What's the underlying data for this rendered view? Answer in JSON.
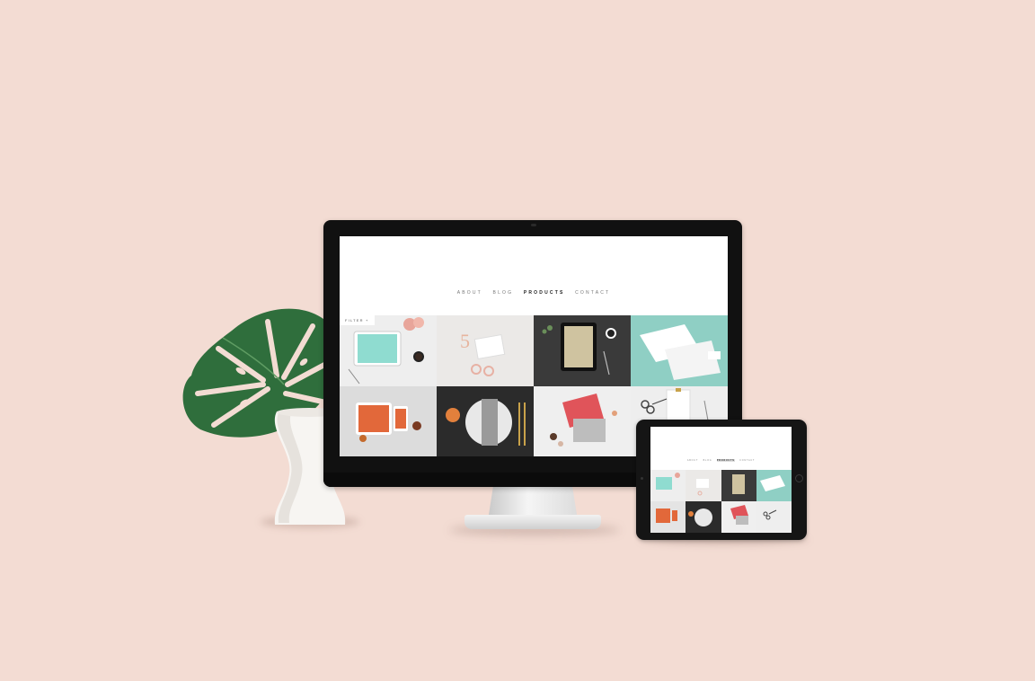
{
  "desktop": {
    "nav": {
      "about": "ABOUT",
      "blog": "BLOG",
      "products": "PRODUCTS",
      "contact": "CONTACT"
    },
    "filter_label": "FILTER +",
    "products": [
      {
        "name": "product-tile-1",
        "bg": "#eeeeee"
      },
      {
        "name": "product-tile-2",
        "bg": "#ebe9e7"
      },
      {
        "name": "product-tile-3",
        "bg": "#3a3a3a"
      },
      {
        "name": "product-tile-4",
        "bg": "#8fcfc4"
      },
      {
        "name": "product-tile-5",
        "bg": "#e4e4e4"
      },
      {
        "name": "product-tile-6",
        "bg": "#2b2b2b"
      },
      {
        "name": "product-tile-7",
        "bg": "#efefef"
      },
      {
        "name": "product-tile-8",
        "bg": "#eeeeee"
      }
    ]
  },
  "tablet": {
    "nav": {
      "about": "ABOUT",
      "blog": "BLOG",
      "products": "PRODUCTS",
      "contact": "CONTACT"
    }
  },
  "colors": {
    "background": "#f3dcd3",
    "accent_orange": "#e2683a",
    "accent_mint": "#8fcfc4",
    "accent_coral": "#e0545a",
    "leaf_green": "#2f6e3c"
  }
}
